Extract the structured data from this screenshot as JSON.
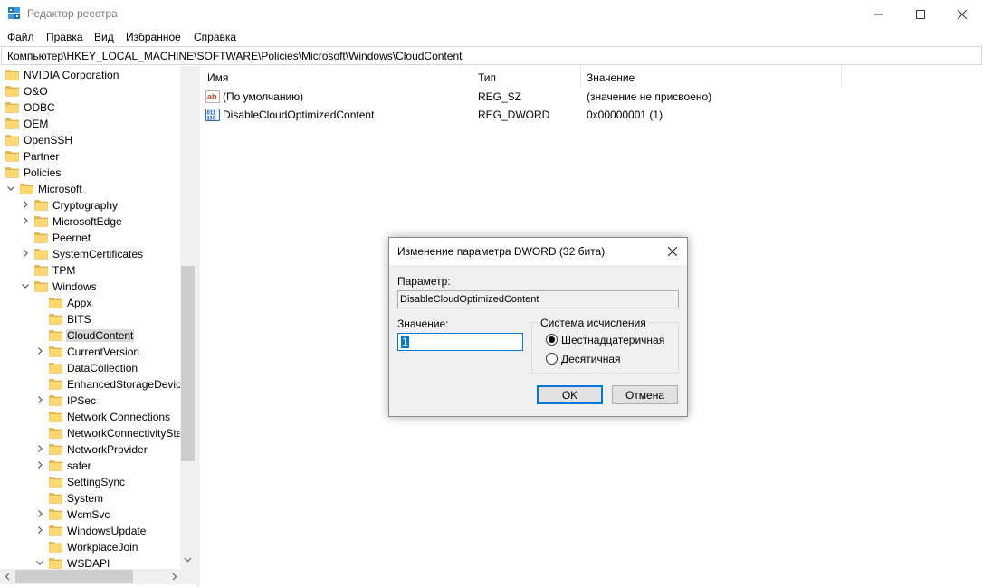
{
  "window": {
    "title": "Редактор реестра"
  },
  "menu": [
    "Файл",
    "Правка",
    "Вид",
    "Избранное",
    "Справка"
  ],
  "address": "Компьютер\\HKEY_LOCAL_MACHINE\\SOFTWARE\\Policies\\Microsoft\\Windows\\CloudContent",
  "tree": [
    {
      "label": "NVIDIA Corporation",
      "level": 0,
      "chevron": "none"
    },
    {
      "label": "O&O",
      "level": 0,
      "chevron": "none"
    },
    {
      "label": "ODBC",
      "level": 0,
      "chevron": "none"
    },
    {
      "label": "OEM",
      "level": 0,
      "chevron": "none"
    },
    {
      "label": "OpenSSH",
      "level": 0,
      "chevron": "none"
    },
    {
      "label": "Partner",
      "level": 0,
      "chevron": "none"
    },
    {
      "label": "Policies",
      "level": 0,
      "chevron": "none"
    },
    {
      "label": "Microsoft",
      "level": 1,
      "chevron": "down"
    },
    {
      "label": "Cryptography",
      "level": 2,
      "chevron": "right"
    },
    {
      "label": "MicrosoftEdge",
      "level": 2,
      "chevron": "right"
    },
    {
      "label": "Peernet",
      "level": 2,
      "chevron": "none"
    },
    {
      "label": "SystemCertificates",
      "level": 2,
      "chevron": "right"
    },
    {
      "label": "TPM",
      "level": 2,
      "chevron": "none"
    },
    {
      "label": "Windows",
      "level": 2,
      "chevron": "down"
    },
    {
      "label": "Appx",
      "level": 3,
      "chevron": "none"
    },
    {
      "label": "BITS",
      "level": 3,
      "chevron": "none"
    },
    {
      "label": "CloudContent",
      "level": 3,
      "chevron": "none",
      "selected": true
    },
    {
      "label": "CurrentVersion",
      "level": 3,
      "chevron": "right"
    },
    {
      "label": "DataCollection",
      "level": 3,
      "chevron": "none"
    },
    {
      "label": "EnhancedStorageDevices",
      "level": 3,
      "chevron": "none"
    },
    {
      "label": "IPSec",
      "level": 3,
      "chevron": "right"
    },
    {
      "label": "Network Connections",
      "level": 3,
      "chevron": "none"
    },
    {
      "label": "NetworkConnectivityStatusIndicator",
      "level": 3,
      "chevron": "none"
    },
    {
      "label": "NetworkProvider",
      "level": 3,
      "chevron": "right"
    },
    {
      "label": "safer",
      "level": 3,
      "chevron": "right"
    },
    {
      "label": "SettingSync",
      "level": 3,
      "chevron": "none"
    },
    {
      "label": "System",
      "level": 3,
      "chevron": "none"
    },
    {
      "label": "WcmSvc",
      "level": 3,
      "chevron": "right"
    },
    {
      "label": "WindowsUpdate",
      "level": 3,
      "chevron": "right"
    },
    {
      "label": "WorkplaceJoin",
      "level": 3,
      "chevron": "none"
    },
    {
      "label": "WSDAPI",
      "level": 3,
      "chevron": "down"
    }
  ],
  "list": {
    "columns": [
      "Имя",
      "Тип",
      "Значение"
    ],
    "rows": [
      {
        "icon": "string-value-icon",
        "name": "(По умолчанию)",
        "type": "REG_SZ",
        "value": "(значение не присвоено)"
      },
      {
        "icon": "binary-value-icon",
        "name": "DisableCloudOptimizedContent",
        "type": "REG_DWORD",
        "value": "0x00000001 (1)"
      }
    ]
  },
  "dialog": {
    "title": "Изменение параметра DWORD (32 бита)",
    "param_label": "Параметр:",
    "param_value": "DisableCloudOptimizedContent",
    "value_label": "Значение:",
    "value": "1",
    "base_group": "Система исчисления",
    "radio_hex": "Шестнадцатеричная",
    "radio_dec": "Десятичная",
    "selected_base": "hex",
    "ok": "OK",
    "cancel": "Отмена"
  }
}
